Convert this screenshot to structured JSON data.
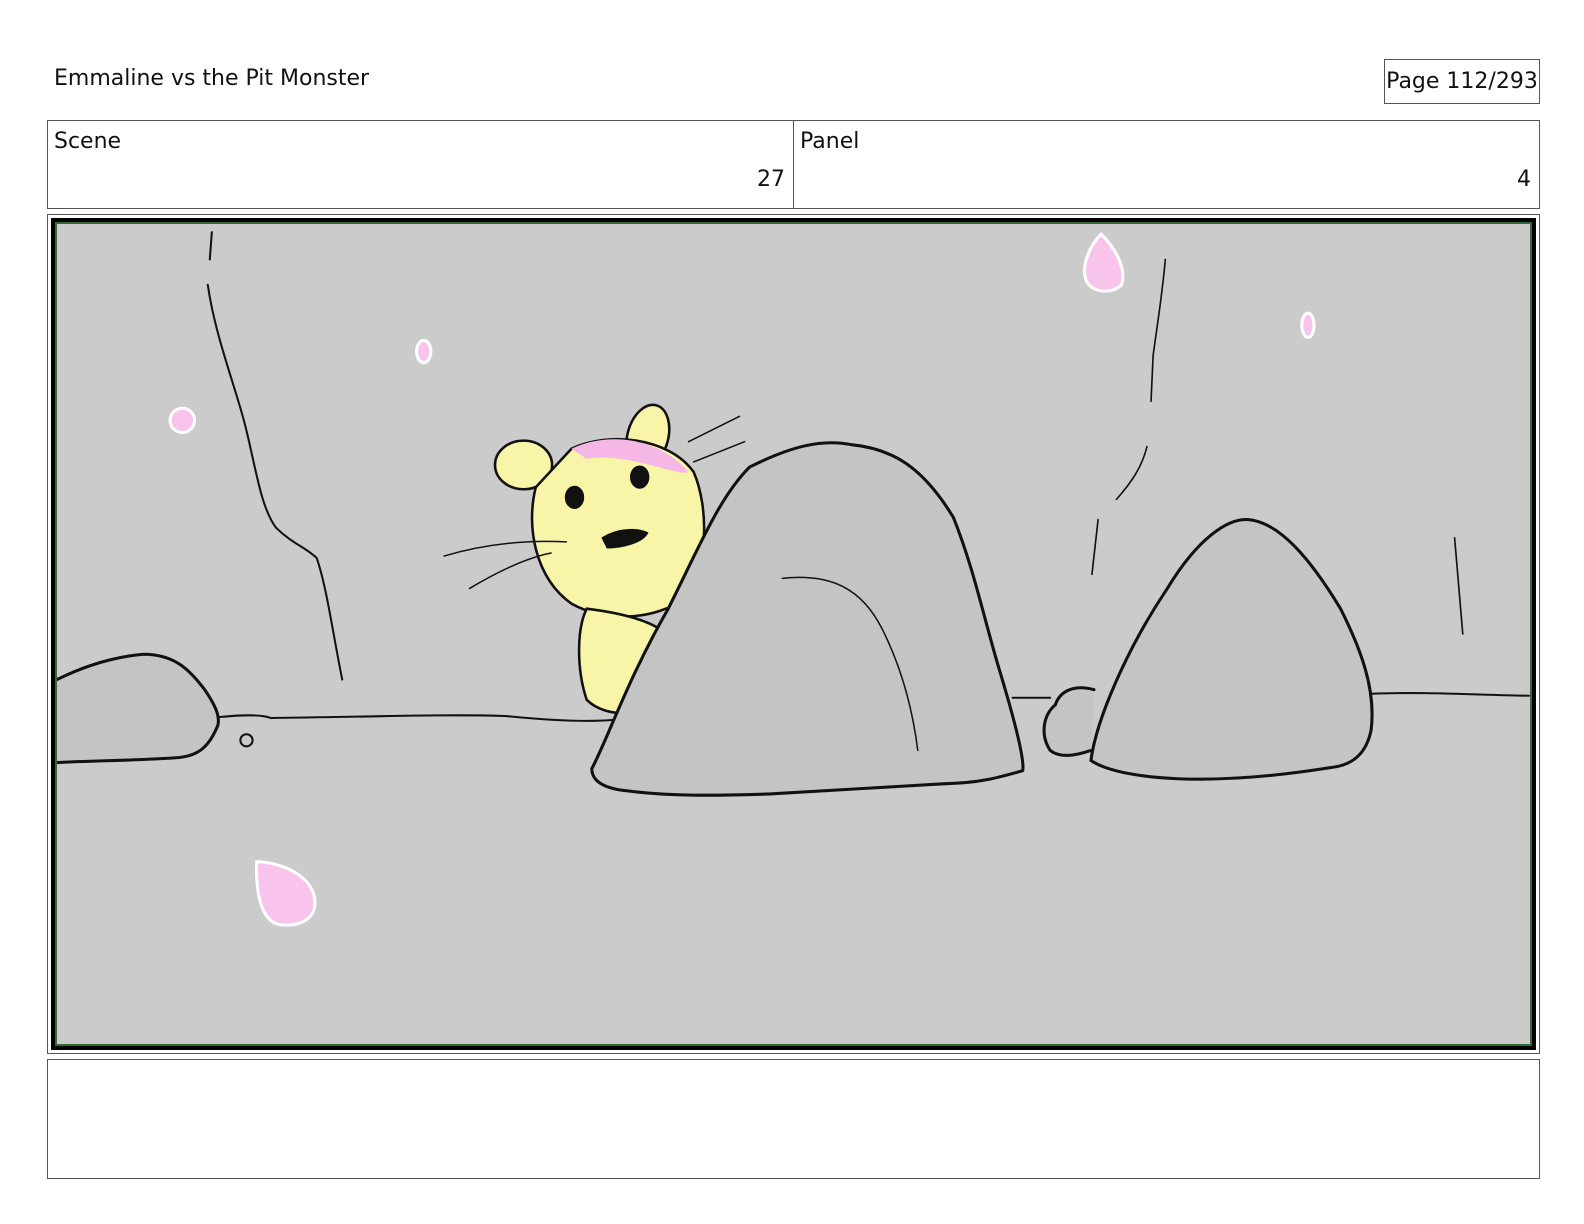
{
  "header": {
    "title": "Emmaline vs the Pit Monster",
    "page_label": "Page 112/293"
  },
  "info": {
    "scene_label": "Scene",
    "scene_value": "27",
    "panel_label": "Panel",
    "panel_value": "4"
  },
  "notes": {
    "text": ""
  },
  "colors": {
    "background": "#cbcbcb",
    "character_fill": "#f8f4a8",
    "hair_fill": "#f5b8e6",
    "petal_fill": "#f8c4ec"
  }
}
